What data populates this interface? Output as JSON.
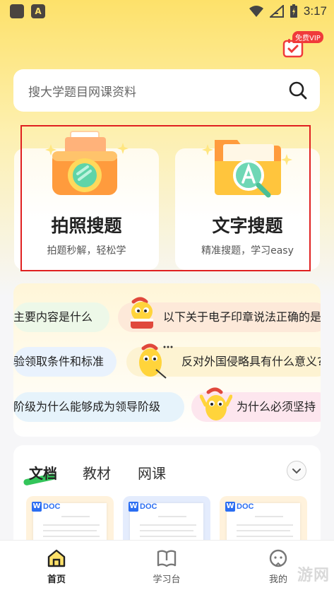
{
  "status_bar": {
    "time": "3:17",
    "app_badge": "A"
  },
  "vip": {
    "badge": "免费VIP"
  },
  "search": {
    "placeholder": "搜大学题目网课资料"
  },
  "features": [
    {
      "title": "拍照搜题",
      "subtitle": "拍题秒解，轻松学"
    },
    {
      "title": "文字搜题",
      "subtitle": "精准搜题，学习easy"
    }
  ],
  "questions": [
    "主要内容是什么",
    "以下关于电子印章说法正确的是",
    "验领取条件和标准",
    "反对外国侵略具有什么意义?",
    "阶级为什么能够成为领导阶级",
    "为什么必须坚持"
  ],
  "tabs": [
    "文档",
    "教材",
    "网课"
  ],
  "doc_cards": [
    {
      "tag": "DOC"
    },
    {
      "tag": "DOC"
    },
    {
      "tag": "DOC"
    }
  ],
  "bottom_nav": [
    {
      "label": "首页"
    },
    {
      "label": "学习台"
    },
    {
      "label": "我的"
    }
  ],
  "watermark": "游网",
  "colors": {
    "brand_yellow": "#fde16a",
    "vip_red": "#f03a3a",
    "highlight_border": "#e02020",
    "tab_underline": "#33c55a",
    "doc_blue": "#2b6ef2"
  }
}
